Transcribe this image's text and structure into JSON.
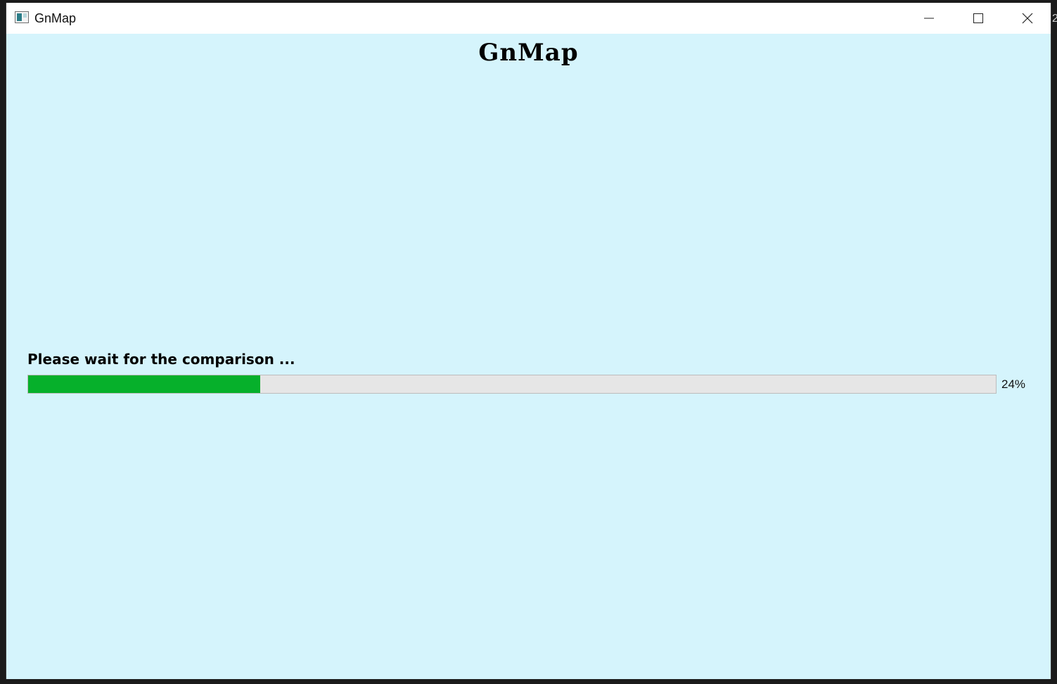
{
  "window": {
    "title": "GnMap",
    "minimize_icon": "minimize-icon",
    "maximize_icon": "maximize-icon",
    "close_icon": "close-icon"
  },
  "main": {
    "heading": "GnMap",
    "status_label": "Please wait for the comparison ...",
    "progress": {
      "percent": 24,
      "text": "24%",
      "fill_color": "#06b02b",
      "track_color": "#e6e6e6"
    }
  },
  "colors": {
    "background": "#d5f4fc",
    "titlebar": "#ffffff"
  },
  "edge_fragment": "2"
}
